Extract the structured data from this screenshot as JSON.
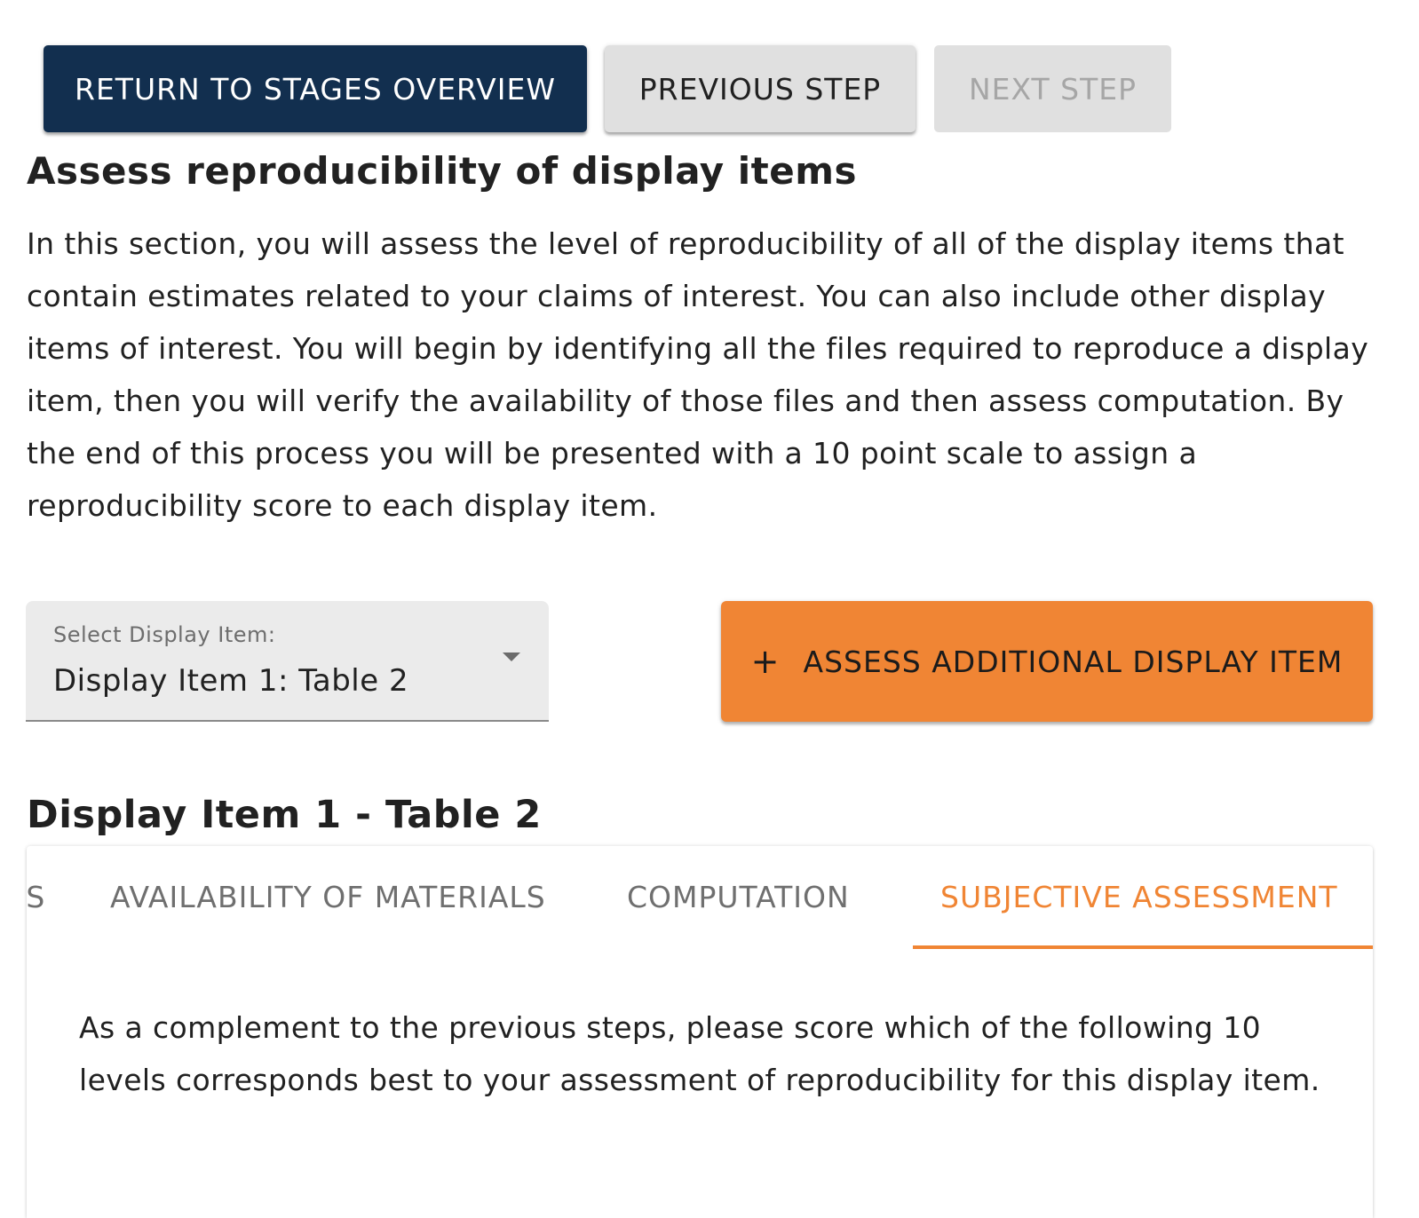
{
  "toolbar": {
    "return_label": "RETURN TO STAGES OVERVIEW",
    "previous_label": "PREVIOUS STEP",
    "next_label": "NEXT STEP"
  },
  "section": {
    "title": "Assess reproducibility of display items",
    "intro": "In this section, you will assess the level of reproducibility of all of the display items that contain estimates related to your claims of interest. You can also include other display items of interest. You will begin by identifying all the files required to reproduce a display item, then you will verify the availability of those files and then assess computation. By the end of this process you will be presented with a 10 point scale to assign a reproducibility score to each display item."
  },
  "display_item_select": {
    "label": "Select Display Item:",
    "selected": "Display Item 1: Table 2"
  },
  "assess_button": {
    "icon": "plus-icon",
    "label": "ASSESS ADDITIONAL DISPLAY ITEM"
  },
  "display_item": {
    "title": "Display Item 1 -  Table 2"
  },
  "tabs": [
    {
      "label": "LS",
      "active": false
    },
    {
      "label": "AVAILABILITY OF MATERIALS",
      "active": false
    },
    {
      "label": "COMPUTATION",
      "active": false
    },
    {
      "label": "SUBJECTIVE ASSESSMENT",
      "active": true
    }
  ],
  "subjective_assessment": {
    "text": "As a complement to the previous steps, please score which of the following 10 levels corresponds best to your assessment of reproducibility for this display item."
  },
  "colors": {
    "primary_navy": "#122f4f",
    "accent_orange": "#f08534",
    "neutral_button": "#e0e0e0"
  }
}
